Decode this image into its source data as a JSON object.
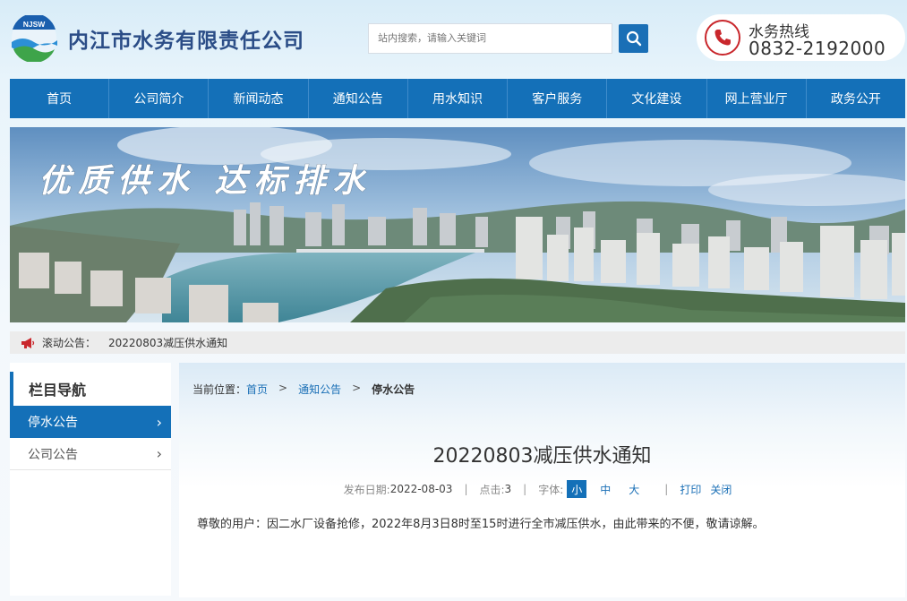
{
  "header": {
    "logo_text": "NJSW",
    "company_name": "内江市水务有限责任公司",
    "search_placeholder": "站内搜索，请输入关键词",
    "hotline_label": "水务热线",
    "hotline_number": "0832-2192000"
  },
  "nav": [
    "首页",
    "公司简介",
    "新闻动态",
    "通知公告",
    "用水知识",
    "客户服务",
    "文化建设",
    "网上营业厅",
    "政务公开"
  ],
  "banner": {
    "slogan": "优质供水  达标排水"
  },
  "ticker": {
    "label": "滚动公告：",
    "text": "20220803减压供水通知"
  },
  "sidebar": {
    "title": "栏目导航",
    "items": [
      {
        "label": "停水公告",
        "active": true
      },
      {
        "label": "公司公告",
        "active": false
      }
    ]
  },
  "breadcrumb": {
    "label": "当前位置：",
    "home": "首页",
    "section": "通知公告",
    "current": "停水公告",
    "sep": ">"
  },
  "article": {
    "title": "20220803减压供水通知",
    "date_label": "发布日期:",
    "date": "2022-08-03",
    "clicks_label": "点击:",
    "clicks": "3",
    "font_label": "字体:",
    "font_small": "小",
    "font_medium": "中",
    "font_large": "大",
    "print": "打印",
    "close": "关闭",
    "body": "尊敬的用户：因二水厂设备抢修，2022年8月3日8时至15时进行全市减压供水，由此带来的不便，敬请谅解。"
  },
  "colors": {
    "primary": "#1470b8",
    "hotline_red": "#c9272c",
    "logo_text": "#2b4d87"
  }
}
